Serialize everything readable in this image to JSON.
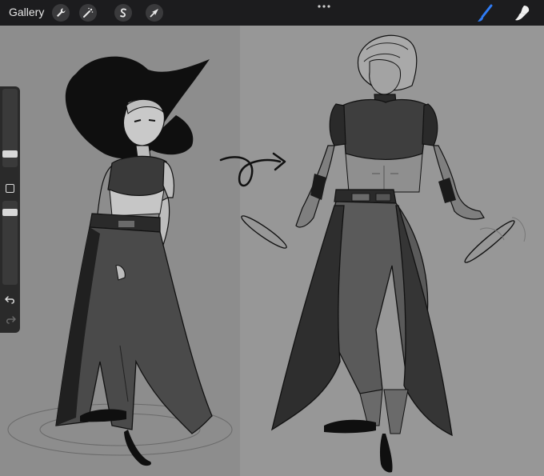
{
  "toolbar": {
    "gallery_label": "Gallery",
    "left_tools": [
      {
        "name": "actions",
        "icon": "wrench-icon"
      },
      {
        "name": "adjustments",
        "icon": "magic-wand-icon"
      },
      {
        "name": "selection",
        "icon": "selection-s-icon"
      },
      {
        "name": "transform",
        "icon": "arrow-cursor-icon"
      }
    ],
    "more_icon": "more-dots-icon",
    "right_tools": [
      {
        "name": "brush",
        "icon": "brush-icon",
        "active": true,
        "color": "#2f7cf6"
      },
      {
        "name": "smudge",
        "icon": "smudge-icon",
        "active": false
      }
    ]
  },
  "sidebar": {
    "size_slider_level": 0.55,
    "opacity_slider_level": 0.85,
    "modify_button_icon": "square-modify-icon",
    "undo_icon": "undo-icon",
    "redo_icon": "redo-icon"
  },
  "colors": {
    "topbar": "#1c1c1e",
    "canvas_left": "#8d8d8d",
    "canvas_right": "#979797",
    "accent_brush": "#2f7cf6"
  }
}
